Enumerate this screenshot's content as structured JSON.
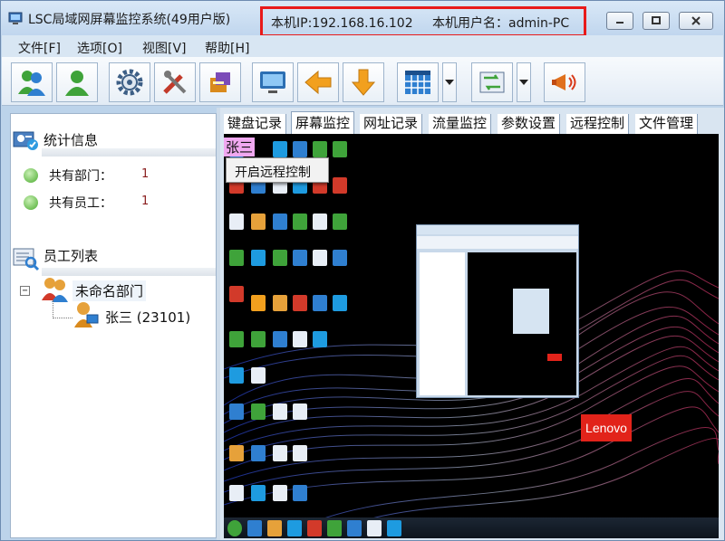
{
  "window": {
    "title": "LSC局域网屏幕监控系统(49用户版)",
    "local_ip": "本机IP:192.168.16.102",
    "local_user": "本机用户名：admin-PC"
  },
  "menu": [
    "文件[F]",
    "选项[O]",
    "视图[V]",
    "帮助[H]"
  ],
  "toolbar": {
    "buttons": [
      "users-add-icon",
      "user-icon",
      "gear-icon",
      "tools-icon",
      "package-icon",
      "monitor-icon",
      "arrow-left-icon",
      "arrow-down-icon",
      "grid-icon",
      "sync-icon",
      "megaphone-icon"
    ]
  },
  "stats": {
    "title": "统计信息",
    "dept_label": "共有部门：",
    "dept_count": "1",
    "emp_label": "共有员工：",
    "emp_count": "1"
  },
  "employees": {
    "title": "员工列表",
    "dept_name": "未命名部门",
    "employee": "张三 (23101)"
  },
  "tabs": [
    "键盘记录",
    "屏幕监控",
    "网址记录",
    "流量监控",
    "参数设置",
    "远程控制",
    "文件管理"
  ],
  "active_tab": "屏幕监控",
  "screen": {
    "name_badge": "张三",
    "context_menu_item": "开启远程控制",
    "brand": "Lenovo"
  },
  "colors": {
    "title_bg": "#c9dcf0",
    "highlight_border": "#e81a1a",
    "stat_value": "#8a1d1d",
    "name_badge": "#f0a8f0",
    "lenovo_red": "#e2231a"
  }
}
